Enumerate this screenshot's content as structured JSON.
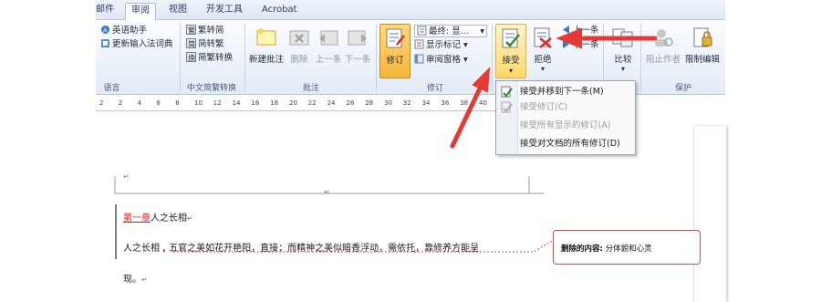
{
  "tabs": [
    {
      "label": "邮件",
      "active": false
    },
    {
      "label": "审阅",
      "active": true
    },
    {
      "label": "视图",
      "active": false
    },
    {
      "label": "开发工具",
      "active": false
    },
    {
      "label": "Acrobat",
      "active": false
    }
  ],
  "ribbon": {
    "language_group": {
      "label": "语言",
      "items": [
        "英语助手",
        "更新输入法词典"
      ]
    },
    "chinese_convert_group": {
      "label": "中文简繁转换",
      "items": [
        "繁转简",
        "简转繁",
        "简繁转换"
      ]
    },
    "comments_group": {
      "label": "批注",
      "new_comment": "新建批注",
      "delete": "删除",
      "previous": "上一条",
      "next": "下一条"
    },
    "tracking_group": {
      "label": "修订",
      "track_changes": "修订",
      "display_for_review": "最终: 显...",
      "show_markup": "显示标记",
      "reviewing_pane": "审阅窗格"
    },
    "changes_group": {
      "accept": "接受",
      "reject": "拒绝",
      "previous": "上一条",
      "next": "下一条"
    },
    "compare_group": {
      "compare": "比较"
    },
    "protect_group": {
      "label": "保护",
      "block_authors": "阻止作者",
      "restrict_editing": "限制编辑"
    }
  },
  "accept_menu": {
    "items": [
      {
        "label": "接受并移到下一条(M)",
        "enabled": true
      },
      {
        "label": "接受修订(C)",
        "enabled": false
      },
      {
        "label": "接受所有显示的修订(A)",
        "enabled": false
      },
      {
        "label": "接受对文档的所有修订(D)",
        "enabled": true
      }
    ]
  },
  "ruler": {
    "ticks": [
      "2",
      "2",
      "4",
      "6",
      "8",
      "10",
      "12",
      "14",
      "16",
      "18",
      "20",
      "22",
      "24",
      "26",
      "28",
      "30",
      "32",
      "34",
      "36",
      "38",
      "40"
    ]
  },
  "document": {
    "chapter_prefix": "第一章",
    "chapter_title": "人之长相",
    "body_line1_a": "人之长相",
    "body_line1_b": "五官之美如花开艳阳，直接；而精神之美似暗香浮动，需依托，靠修养方能呈",
    "body_line2": "现。",
    "para_mark": "↵"
  },
  "comment": {
    "prefix": "删除的内容:",
    "text": "分体貌和心灵"
  },
  "colors": {
    "arrow": "#e53935",
    "highlight": "#ffd86a",
    "revision": "#d82020"
  }
}
